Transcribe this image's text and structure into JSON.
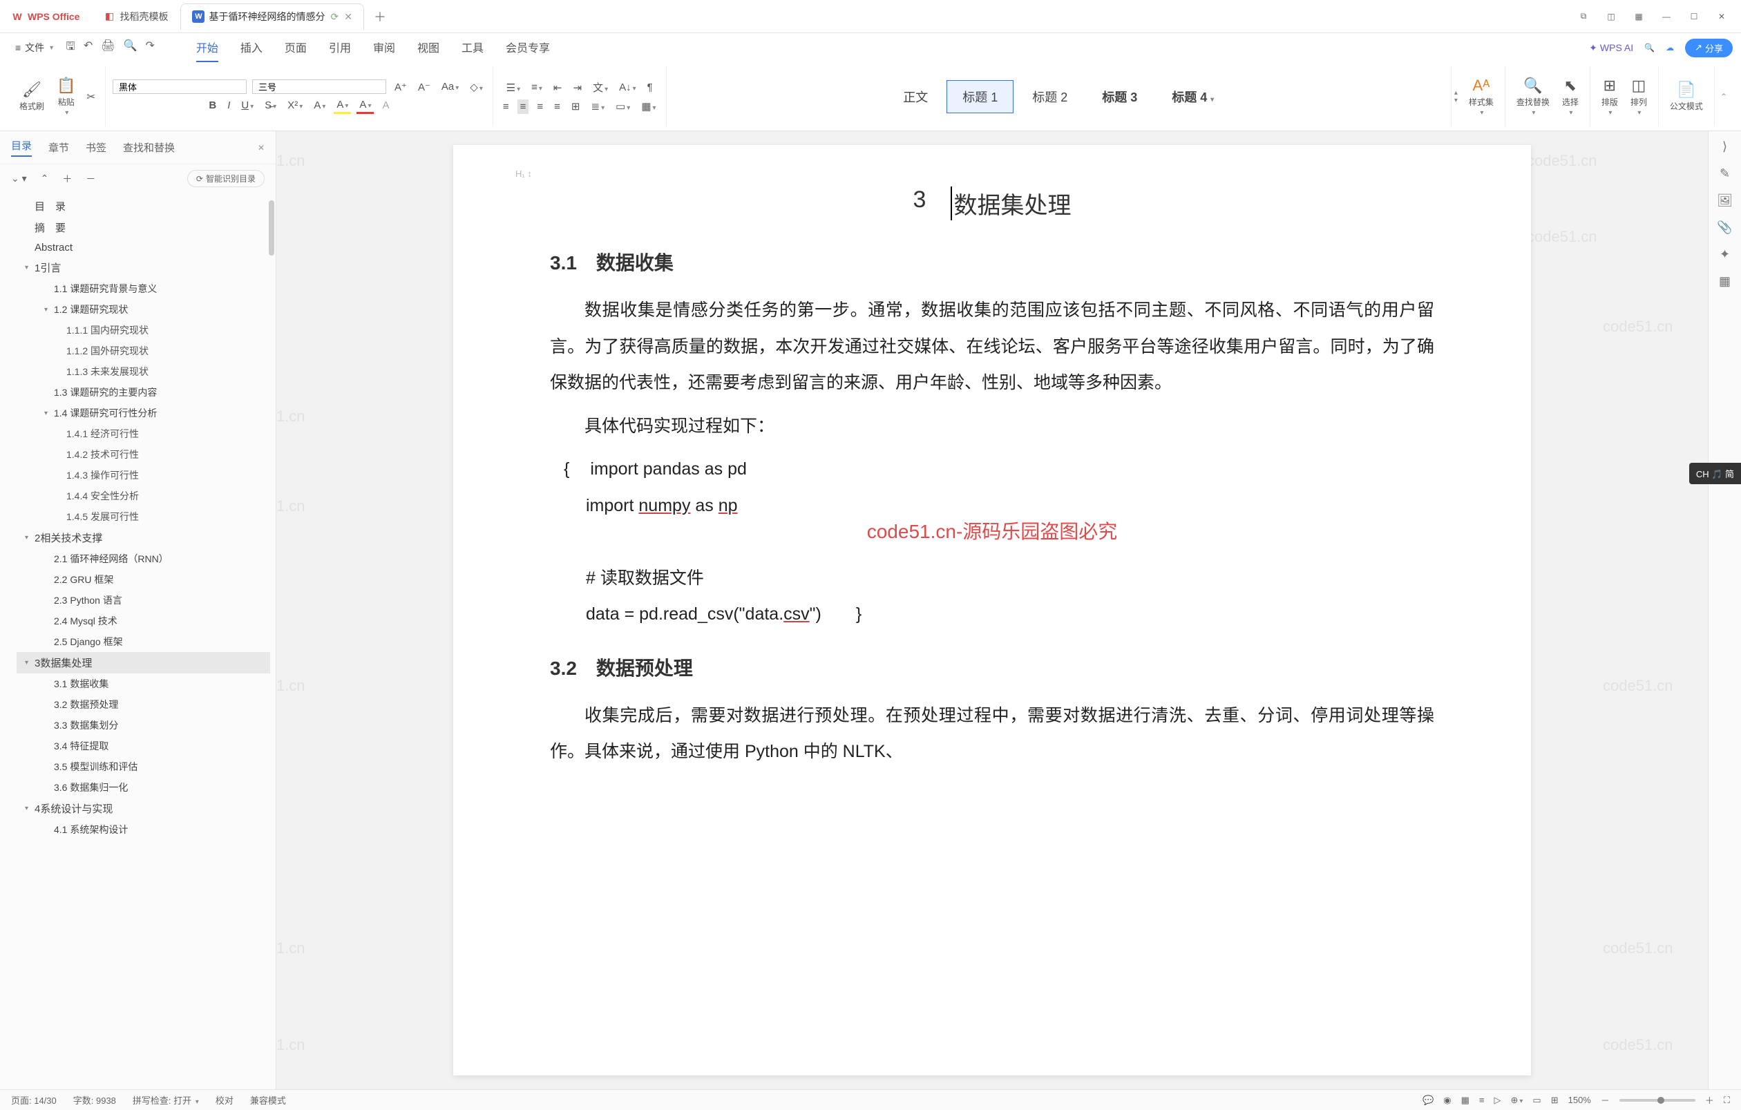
{
  "titlebar": {
    "wps_label": "WPS Office",
    "tab2": "找稻壳模板",
    "tab3": "基于循环神经网络的情感分",
    "newtab": "＋"
  },
  "menubar": {
    "file": "文件",
    "tabs": [
      "开始",
      "插入",
      "页面",
      "引用",
      "审阅",
      "视图",
      "工具",
      "会员专享"
    ],
    "wps_ai": "WPS AI",
    "share": "分享"
  },
  "ribbon": {
    "brush": "格式刷",
    "paste": "粘贴",
    "font_name": "黑体",
    "font_size": "三号",
    "styles": [
      "正文",
      "标题 1",
      "标题 2",
      "标题 3",
      "标题 4"
    ],
    "style_gallery": "样式集",
    "find_replace": "查找替换",
    "select": "选择",
    "layout": "排版",
    "columns": "排列",
    "formula": "公文模式"
  },
  "left_panel": {
    "tabs": [
      "目录",
      "章节",
      "书签",
      "查找和替换"
    ],
    "smart_toc": "智能识别目录",
    "items": [
      {
        "label": "目　录",
        "level": 1
      },
      {
        "label": "摘　要",
        "level": 1
      },
      {
        "label": "Abstract",
        "level": 1
      },
      {
        "label": "1引言",
        "level": 1,
        "caret": true
      },
      {
        "label": "1.1 课题研究背景与意义",
        "level": 2
      },
      {
        "label": "1.2 课题研究现状",
        "level": 2,
        "caret": true
      },
      {
        "label": "1.1.1 国内研究现状",
        "level": 3
      },
      {
        "label": "1.1.2 国外研究现状",
        "level": 3
      },
      {
        "label": "1.1.3 未来发展现状",
        "level": 3
      },
      {
        "label": "1.3 课题研究的主要内容",
        "level": 2
      },
      {
        "label": "1.4 课题研究可行性分析",
        "level": 2,
        "caret": true
      },
      {
        "label": "1.4.1 经济可行性",
        "level": 3
      },
      {
        "label": "1.4.2 技术可行性",
        "level": 3
      },
      {
        "label": "1.4.3 操作可行性",
        "level": 3
      },
      {
        "label": "1.4.4 安全性分析",
        "level": 3
      },
      {
        "label": "1.4.5 发展可行性",
        "level": 3
      },
      {
        "label": "2相关技术支撑",
        "level": 1,
        "caret": true
      },
      {
        "label": "2.1 循环神经网络（RNN）",
        "level": 2
      },
      {
        "label": "2.2 GRU 框架",
        "level": 2
      },
      {
        "label": "2.3 Python 语言",
        "level": 2
      },
      {
        "label": "2.4 Mysql 技术",
        "level": 2
      },
      {
        "label": "2.5 Django 框架",
        "level": 2
      },
      {
        "label": "3数据集处理",
        "level": 1,
        "caret": true,
        "active": true
      },
      {
        "label": "3.1 数据收集",
        "level": 2
      },
      {
        "label": "3.2 数据预处理",
        "level": 2
      },
      {
        "label": "3.3 数据集划分",
        "level": 2
      },
      {
        "label": "3.4 特征提取",
        "level": 2
      },
      {
        "label": "3.5 模型训练和评估",
        "level": 2
      },
      {
        "label": "3.6 数据集归一化",
        "level": 2
      },
      {
        "label": "4系统设计与实现",
        "level": 1,
        "caret": true
      },
      {
        "label": "4.1 系统架构设计",
        "level": 2
      }
    ]
  },
  "document": {
    "h1_num": "3",
    "h1_title": "数据集处理",
    "h2_1": "3.1　数据收集",
    "para1": "数据收集是情感分类任务的第一步。通常，数据收集的范围应该包括不同主题、不同风格、不同语气的用户留言。为了获得高质量的数据，本次开发通过社交媒体、在线论坛、客户服务平台等途径收集用户留言。同时，为了确保数据的代表性，还需要考虑到留言的来源、用户年龄、性别、地域等多种因素。",
    "para2": "具体代码实现过程如下：",
    "code1_brace": "{",
    "code1": "import pandas as pd",
    "code2_a": "import ",
    "code2_b": "numpy",
    "code2_c": " as ",
    "code2_d": "np",
    "code3": "# 读取数据文件",
    "code4_a": "data = pd.read_csv(\"data.",
    "code4_b": "csv",
    "code4_c": "\")　　}",
    "h2_2": "3.2　数据预处理",
    "para3": "收集完成后，需要对数据进行预处理。在预处理过程中，需要对数据进行清洗、去重、分词、停用词处理等操作。具体来说，通过使用 Python 中的 NLTK、",
    "red_watermark": "code51.cn-源码乐园盗图必究",
    "para_mark": "H₁ ↕"
  },
  "statusbar": {
    "page": "页面: 14/30",
    "words": "字数: 9938",
    "spell": "拼写检查: 打开",
    "proof": "校对",
    "compat": "兼容模式",
    "zoom": "150%"
  },
  "ime": "CH 🎵 简",
  "watermark": "code51.cn"
}
